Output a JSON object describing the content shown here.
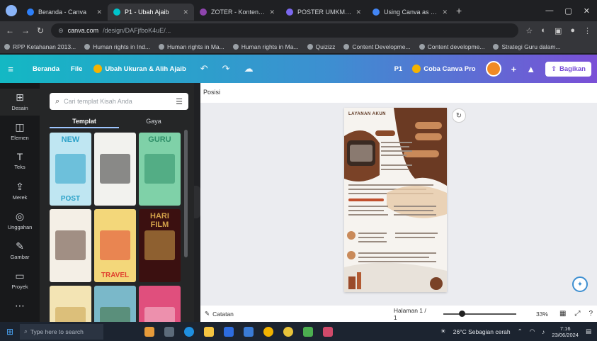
{
  "browser": {
    "tabs": [
      {
        "title": "Beranda - Canva",
        "color": "#2d7ff9",
        "active": false
      },
      {
        "title": "P1 - Ubah Ajaib",
        "color": "#00c4cc",
        "active": true
      },
      {
        "title": "ZOTER - Konten Instagram",
        "color": "#8e44ad",
        "active": false
      },
      {
        "title": "POSTER UMKM - Konten s",
        "color": "#7b68ee",
        "active": false
      },
      {
        "title": "Using Canva as Media for I",
        "color": "#4285f4",
        "active": false
      }
    ],
    "new_tab": "+",
    "window_controls": [
      "—",
      "▢",
      "✕"
    ],
    "url_domain": "canva.com",
    "url_path": "/design/DAFjfboK4uE/...",
    "bookmarks": [
      "RPP Ketahanan 2013...",
      "Human rights in Ind...",
      "Human rights in Ma...",
      "Human rights in Ma...",
      "Quizizz",
      "Content Developme...",
      "Content developme...",
      "Strategi Guru dalam..."
    ]
  },
  "canva": {
    "menu_icon": "≡",
    "home": "Beranda",
    "file": "File",
    "resize": "Ubah Ukuran & Alih Ajaib",
    "undo": "↶",
    "redo": "↷",
    "cloud": "☁",
    "page_code": "P1",
    "trial": "Coba Canva Pro",
    "plus": "+",
    "insights": "▲",
    "share": "Bagikan"
  },
  "rail": [
    {
      "icon": "⊞",
      "label": "Desain",
      "active": true
    },
    {
      "icon": "◫",
      "label": "Elemen",
      "active": false
    },
    {
      "icon": "T",
      "label": "Teks",
      "active": false
    },
    {
      "icon": "⇪",
      "label": "Merek",
      "active": false
    },
    {
      "icon": "◎",
      "label": "Unggahan",
      "active": false
    },
    {
      "icon": "✎",
      "label": "Gambar",
      "active": false
    },
    {
      "icon": "▭",
      "label": "Proyek",
      "active": false
    },
    {
      "icon": "⋯",
      "label": "",
      "active": false
    }
  ],
  "panel": {
    "search_placeholder": "Cari templat Kisah Anda",
    "tabs": [
      {
        "label": "Templat",
        "active": true
      },
      {
        "label": "Gaya",
        "active": false
      }
    ],
    "thumbs": [
      {
        "bg": "#bfe6f2",
        "title": "NEW",
        "footer": "POST",
        "accent": "#2aa1c8"
      },
      {
        "bg": "#f2f2ee",
        "title": "",
        "footer": "",
        "accent": "#333333"
      },
      {
        "bg": "#7fd1a8",
        "title": "GURU",
        "footer": "",
        "accent": "#2f8f68"
      },
      {
        "bg": "#f4efe6",
        "title": "",
        "footer": "",
        "accent": "#5c4033"
      },
      {
        "bg": "#f3d77a",
        "title": "",
        "footer": "TRAVEL",
        "accent": "#e0412f"
      },
      {
        "bg": "#3b1010",
        "title": "HARI FILM",
        "footer": "",
        "accent": "#d4a24a"
      },
      {
        "bg": "#f3e4b4",
        "title": "",
        "footer": "",
        "accent": "#c9a04a"
      },
      {
        "bg": "#7ab8c9",
        "title": "",
        "footer": "",
        "accent": "#3f6e3b"
      },
      {
        "bg": "#e04f7d",
        "title": "",
        "footer": "",
        "accent": "#f7c6d6"
      }
    ]
  },
  "workspace": {
    "position_label": "Posisi",
    "poster_title": "LAYANAN AKUN",
    "notes": "Catatan",
    "page_indicator": "Halaman 1 / 1",
    "zoom": "33%",
    "help": "?",
    "refresh": "↻"
  },
  "taskbar": {
    "search_placeholder": "Type here to search",
    "weather": "26°C  Sebagian cerah",
    "time": "7:16",
    "date": "23/06/2024"
  }
}
